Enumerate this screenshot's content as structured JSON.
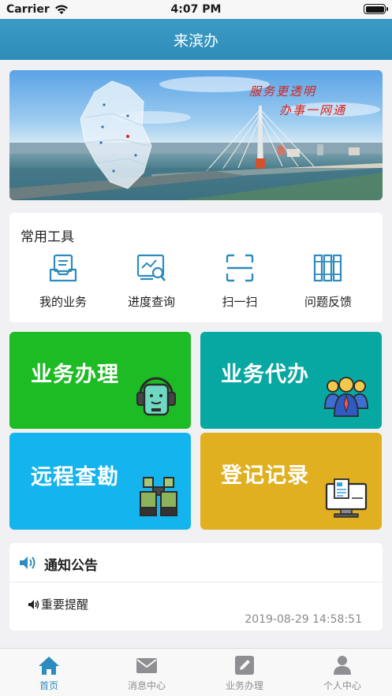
{
  "status_bar": {
    "carrier": "Carrier",
    "time": "4:07 PM"
  },
  "nav": {
    "title": "来滨办"
  },
  "banner": {
    "slogan_line1": "服务更透明",
    "slogan_line2": "办事一网通"
  },
  "tools": {
    "title": "常用工具",
    "items": [
      {
        "label": "我的业务",
        "icon": "inbox-tray-icon"
      },
      {
        "label": "进度查询",
        "icon": "search-progress-icon"
      },
      {
        "label": "扫一扫",
        "icon": "scan-icon"
      },
      {
        "label": "问题反馈",
        "icon": "books-icon"
      }
    ]
  },
  "tiles": [
    {
      "label": "业务办理",
      "color": "#1dbb24",
      "icon": "headset-robot-icon"
    },
    {
      "label": "业务代办",
      "color": "#07a8a1",
      "icon": "people-group-icon"
    },
    {
      "label": "远程查勘",
      "color": "#14b4ee",
      "icon": "binoculars-icon"
    },
    {
      "label": "登记记录",
      "color": "#e0b020",
      "icon": "monitor-document-icon"
    }
  ],
  "notice": {
    "title": "通知公告",
    "item": "重要提醒",
    "date": "2019-08-29 14:58:51"
  },
  "tabbar": {
    "items": [
      {
        "label": "首页",
        "icon": "home-icon",
        "active": true
      },
      {
        "label": "消息中心",
        "icon": "mail-icon",
        "active": false
      },
      {
        "label": "业务办理",
        "icon": "edit-icon",
        "active": false
      },
      {
        "label": "个人中心",
        "icon": "user-icon",
        "active": false
      }
    ]
  },
  "colors": {
    "accent": "#2e8bbd",
    "nav_bg": "#3a9bc3"
  }
}
